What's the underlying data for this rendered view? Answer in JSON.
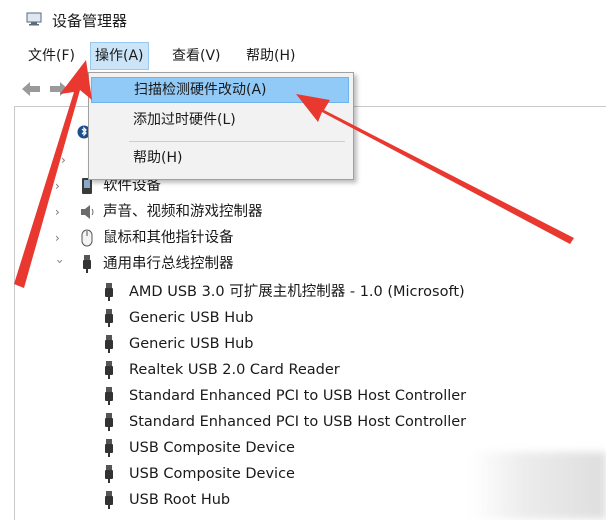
{
  "window": {
    "title": "设备管理器",
    "icon": "device-manager-icon"
  },
  "menubar": [
    {
      "label": "文件(F)",
      "active": false
    },
    {
      "label": "操作(A)",
      "active": true
    },
    {
      "label": "查看(V)",
      "active": false
    },
    {
      "label": "帮助(H)",
      "active": false
    }
  ],
  "toolbar": {
    "icons": [
      "back-arrow-icon",
      "forward-arrow-icon"
    ]
  },
  "dropdown": {
    "items": [
      {
        "label": "扫描检测硬件改动(A)",
        "highlighted": true
      },
      {
        "label": "添加过时硬件(L)",
        "highlighted": false
      },
      {
        "label": "帮助(H)",
        "highlighted": false
      }
    ]
  },
  "tree": {
    "categories": [
      {
        "label": "软件设备",
        "icon": "software-device-icon",
        "expanded": false
      },
      {
        "label": "声音、视频和游戏控制器",
        "icon": "speaker-icon",
        "expanded": false
      },
      {
        "label": "鼠标和其他指针设备",
        "icon": "mouse-icon",
        "expanded": false
      },
      {
        "label": "通用串行总线控制器",
        "icon": "usb-icon",
        "expanded": true
      }
    ],
    "usb_devices": [
      "AMD USB 3.0 可扩展主机控制器 - 1.0 (Microsoft)",
      "Generic USB Hub",
      "Generic USB Hub",
      "Realtek USB 2.0 Card Reader",
      "Standard Enhanced PCI to USB Host Controller",
      "Standard Enhanced PCI to USB Host Controller",
      "USB Composite Device",
      "USB Composite Device",
      "USB Root Hub"
    ]
  },
  "colors": {
    "menu_active_bg": "#cce4f7",
    "dropdown_highlight": "#91c9f7",
    "annotation_arrow": "#e8382f"
  }
}
